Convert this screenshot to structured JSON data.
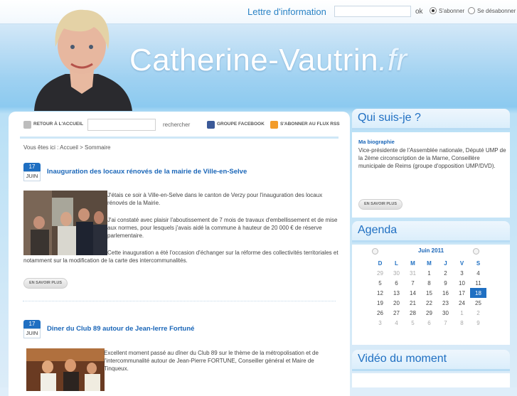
{
  "topbar": {
    "newsletter_label": "Lettre d'information",
    "email_value": "",
    "ok_label": "ok",
    "subscribe_label": "S'abonner",
    "unsubscribe_label": "Se désabonner"
  },
  "header": {
    "title_main": "Catherine-Vautrin",
    "title_ext": ".fr"
  },
  "toolbar": {
    "home_label": "RETOUR À L'ACCUEIL",
    "search_value": "",
    "search_label": "rechercher",
    "facebook_label": "GROUPE FACEBOOK",
    "rss_label": "S'ABONNER AU FLUX RSS"
  },
  "breadcrumb": "Vous êtes ici : Accueil > Sommaire",
  "posts": [
    {
      "day": "17",
      "month": "JUIN",
      "title": "Inauguration des locaux rénovés de la mairie de Ville-en-Selve",
      "text1": "J'étais ce soir à Ville-en-Selve dans le canton de Verzy pour l'inauguration des locaux rénovés de la Mairie.",
      "text2": "J'ai constaté avec plaisir l'aboutissement de 7 mois de travaux d'embellissement et de mise aux normes, pour lesquels j'avais aidé la commune à hauteur de 20 000 € de réserve parlementaire.",
      "text3": "Cette inauguration a été l'occasion d'échanger sur la réforme des collectivités territoriales et notamment sur la modification de la carte des intercommunalités.",
      "more_label": "EN SAVOIR PLUS"
    },
    {
      "day": "17",
      "month": "JUIN",
      "title": "Diner du Club 89 autour de Jean-Ierre Fortuné",
      "text1": "Excellent moment passé au dîner du Club 89 sur le thème de la métropolisation et de l'intercommunalité autour de Jean-Pierre FORTUNE, Conseiller général et Maire de Tinqueux."
    }
  ],
  "sidebar": {
    "about_title": "Qui suis-je ?",
    "bio_title": "Ma biographie",
    "bio_text": "Vice-présidente de l'Assemblée nationale, Député UMP de la 2ème circonscription de la Marne, Conseillère municipale de Reims (groupe d'opposition UMP/DVD).",
    "bio_more": "EN SAVOIR PLUS",
    "agenda_title": "Agenda",
    "video_title": "Vidéo du moment"
  },
  "calendar": {
    "month": "Juin 2011",
    "weekdays": [
      "D",
      "L",
      "M",
      "M",
      "J",
      "V",
      "S"
    ],
    "weeks": [
      [
        "29",
        "30",
        "31",
        "1",
        "2",
        "3",
        "4"
      ],
      [
        "5",
        "6",
        "7",
        "8",
        "9",
        "10",
        "11"
      ],
      [
        "12",
        "13",
        "14",
        "15",
        "16",
        "17",
        "18"
      ],
      [
        "19",
        "20",
        "21",
        "22",
        "23",
        "24",
        "25"
      ],
      [
        "26",
        "27",
        "28",
        "29",
        "30",
        "1",
        "2"
      ],
      [
        "3",
        "4",
        "5",
        "6",
        "7",
        "8",
        "9"
      ]
    ],
    "today": "18"
  },
  "colors": {
    "accent": "#1f6fc2",
    "link": "#1a66b8",
    "header_sky": "#8ccaf0"
  }
}
